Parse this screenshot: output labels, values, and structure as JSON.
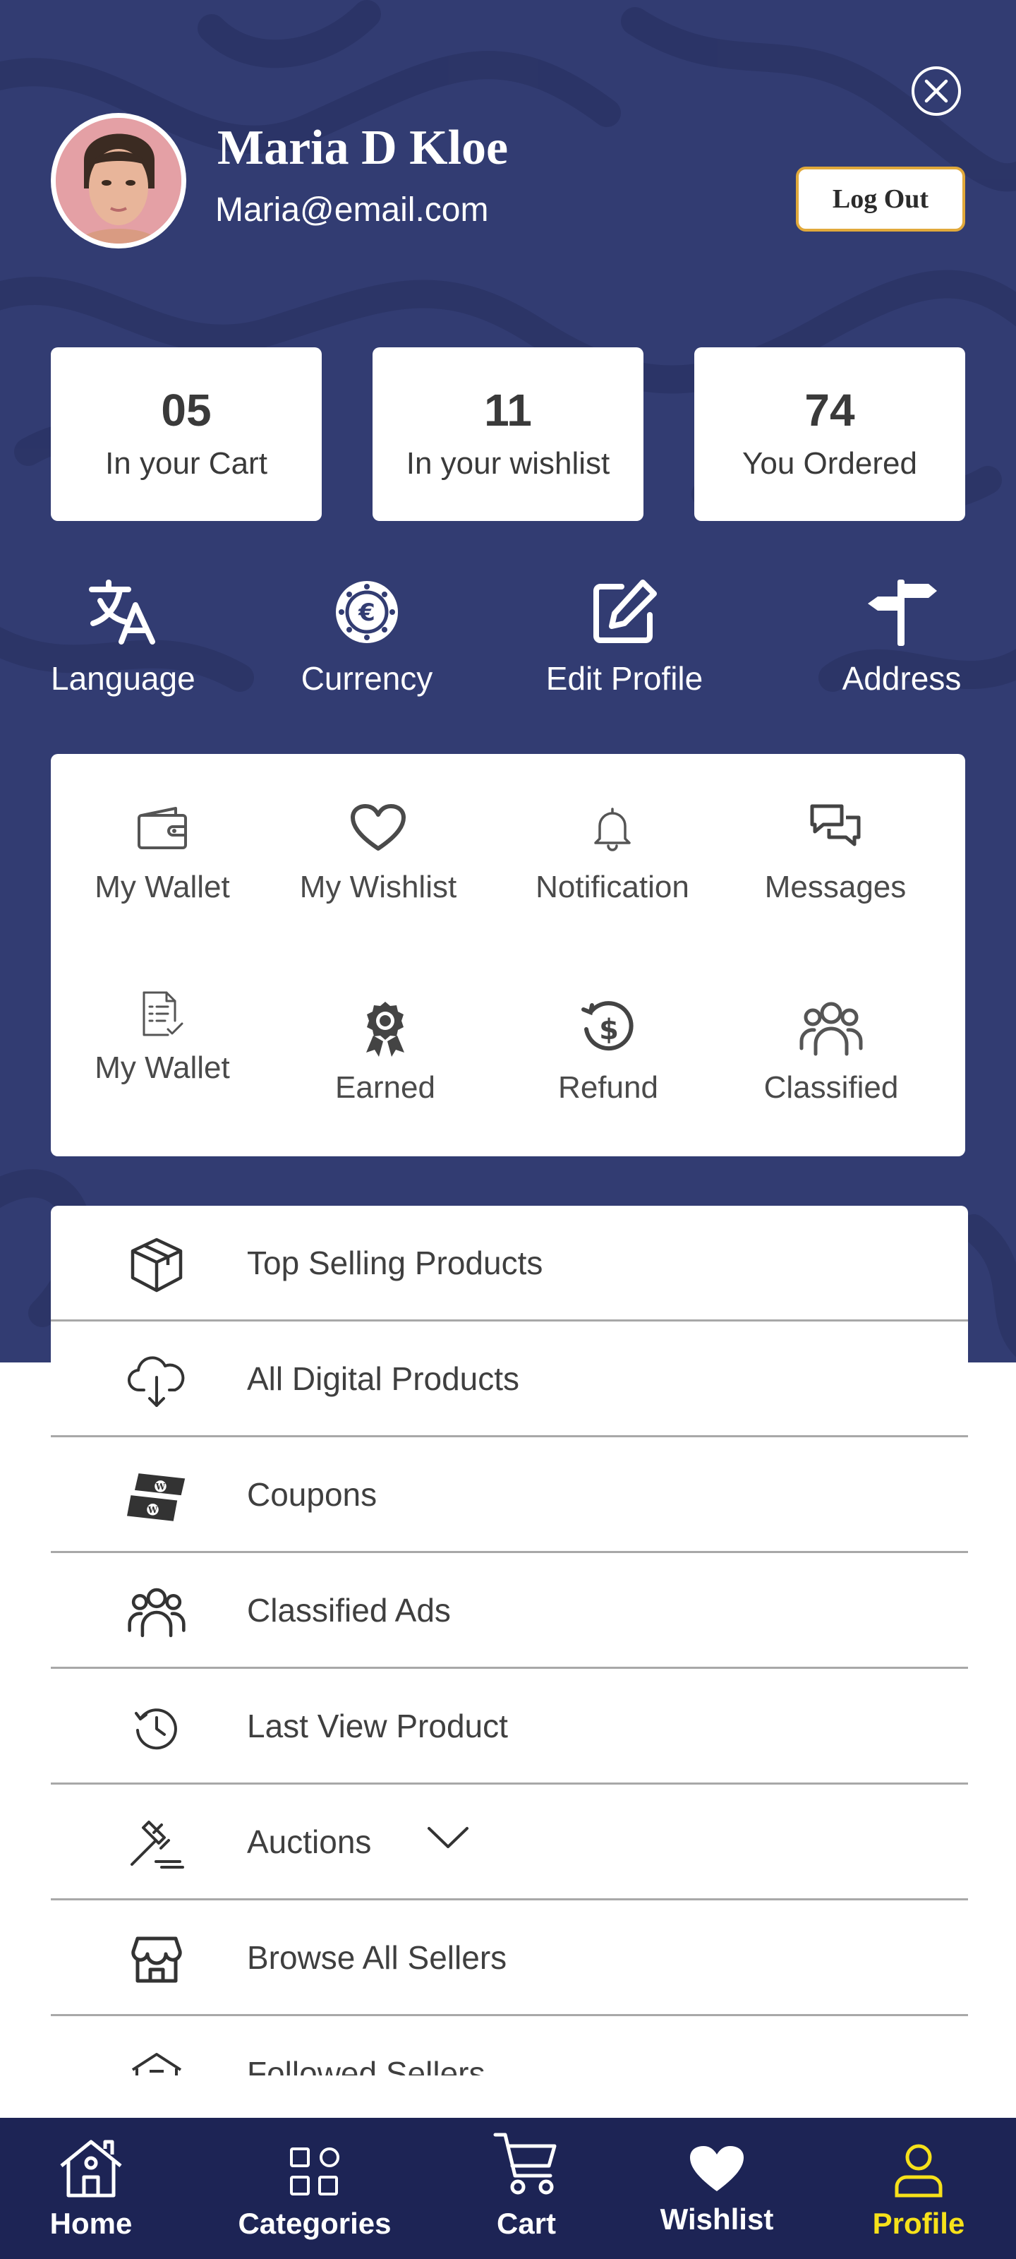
{
  "header": {
    "user_name": "Maria D Kloe",
    "user_email": "Maria@email.com",
    "logout_label": "Log Out",
    "close_icon": "close-circle-icon"
  },
  "stats": [
    {
      "value": "05",
      "label": "In your Cart"
    },
    {
      "value": "11",
      "label": "In your wishlist"
    },
    {
      "value": "74",
      "label": "You Ordered"
    }
  ],
  "quick_actions": [
    {
      "label": "Language",
      "icon": "translate-icon"
    },
    {
      "label": "Currency",
      "icon": "euro-coin-icon"
    },
    {
      "label": "Edit Profile",
      "icon": "edit-icon"
    },
    {
      "label": "Address",
      "icon": "signpost-icon"
    }
  ],
  "grid": [
    {
      "label": "My Wallet",
      "icon": "wallet-icon"
    },
    {
      "label": "My Wishlist",
      "icon": "heart-outline-icon"
    },
    {
      "label": "Notification",
      "icon": "bell-icon"
    },
    {
      "label": "Messages",
      "icon": "chat-bubbles-icon"
    },
    {
      "label": "My Wallet",
      "icon": "document-check-icon"
    },
    {
      "label": "Earned",
      "icon": "award-ribbon-icon"
    },
    {
      "label": "Refund",
      "icon": "refund-dollar-icon"
    },
    {
      "label": "Classified",
      "icon": "users-group-icon"
    }
  ],
  "menu": [
    {
      "label": "Top Selling Products",
      "icon": "box-icon"
    },
    {
      "label": "All Digital Products",
      "icon": "cloud-download-icon"
    },
    {
      "label": "Coupons",
      "icon": "coupon-icon"
    },
    {
      "label": "Classified Ads",
      "icon": "users-group-icon"
    },
    {
      "label": "Last View Product",
      "icon": "history-icon"
    },
    {
      "label": "Auctions",
      "icon": "gavel-icon"
    },
    {
      "label": "Browse All Sellers",
      "icon": "store-icon"
    },
    {
      "label": "Followed Sellers",
      "icon": "store-follow-icon"
    }
  ],
  "bottom_nav": [
    {
      "label": "Home",
      "icon": "home-icon"
    },
    {
      "label": "Categories",
      "icon": "grid-squares-icon"
    },
    {
      "label": "Cart",
      "icon": "cart-icon"
    },
    {
      "label": "Wishlist",
      "icon": "heart-filled-icon"
    },
    {
      "label": "Profile",
      "icon": "user-icon",
      "active": true
    }
  ],
  "colors": {
    "hero_bg": "#323c72",
    "nav_bg": "#1d2455",
    "logout_border": "#e1a93b",
    "active_nav": "#f6e11a"
  }
}
